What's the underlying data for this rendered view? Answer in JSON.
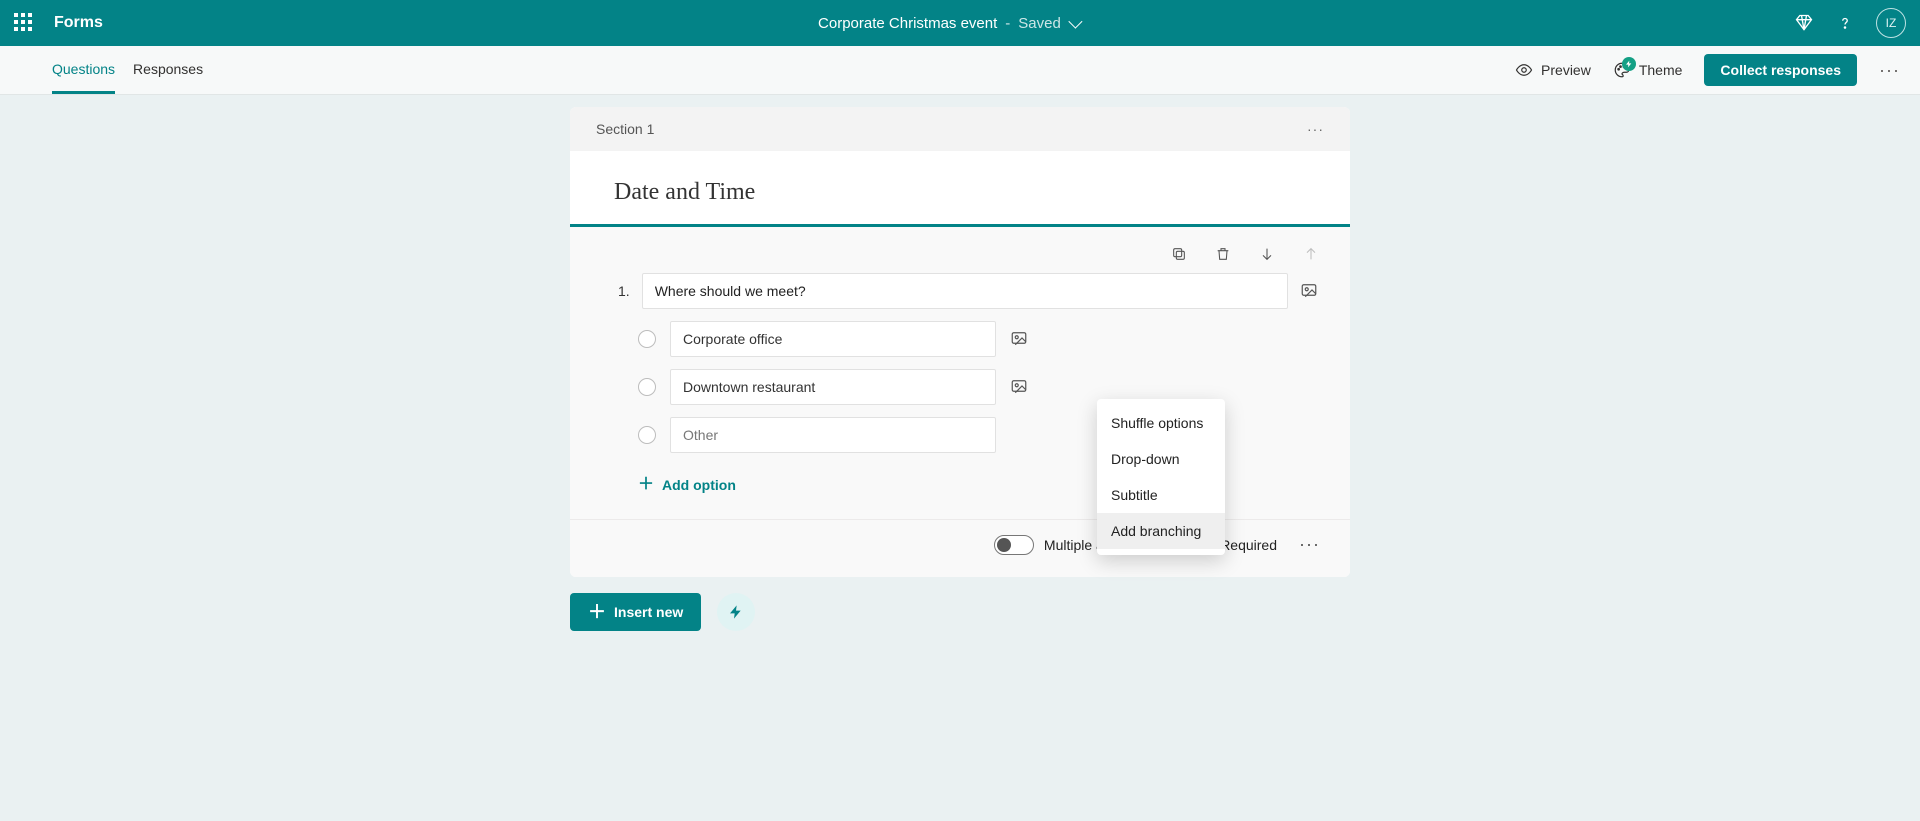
{
  "header": {
    "brand": "Forms",
    "doc_title": "Corporate Christmas event",
    "status_sep": "-",
    "status": "Saved",
    "avatar_initials": "IZ"
  },
  "command": {
    "tabs": {
      "questions": "Questions",
      "responses": "Responses"
    },
    "preview": "Preview",
    "theme": "Theme",
    "collect": "Collect responses"
  },
  "section": {
    "label": "Section 1",
    "title": "Date and Time"
  },
  "question": {
    "number": "1.",
    "text": "Where should we meet?",
    "options": [
      "Corporate office",
      "Downtown restaurant"
    ],
    "other_placeholder": "Other",
    "add_option": "Add option",
    "multiple_answers": "Multiple answers",
    "required": "Required"
  },
  "insert": {
    "button": "Insert new"
  },
  "menu": {
    "shuffle": "Shuffle options",
    "dropdown": "Drop-down",
    "subtitle": "Subtitle",
    "branching": "Add branching"
  }
}
